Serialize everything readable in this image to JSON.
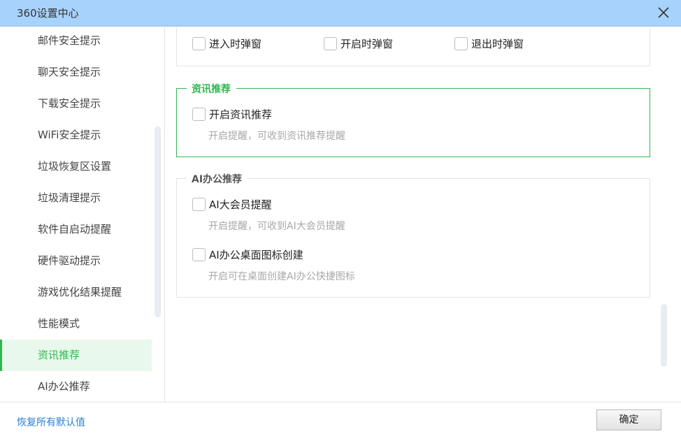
{
  "window": {
    "title": "360设置中心"
  },
  "sidebar": {
    "items": [
      {
        "label": "邮件安全提示"
      },
      {
        "label": "聊天安全提示"
      },
      {
        "label": "下载安全提示"
      },
      {
        "label": "WiFi安全提示"
      },
      {
        "label": "垃圾恢复区设置"
      },
      {
        "label": "垃圾清理提示"
      },
      {
        "label": "软件自启动提醒"
      },
      {
        "label": "硬件驱动提示"
      },
      {
        "label": "游戏优化结果提醒"
      },
      {
        "label": "性能模式"
      },
      {
        "label": "资讯推荐",
        "active": true
      },
      {
        "label": "AI办公推荐"
      }
    ]
  },
  "popup_section": {
    "options": [
      {
        "label": "进入时弹窗",
        "checked": false
      },
      {
        "label": "开启时弹窗",
        "checked": false
      },
      {
        "label": "退出时弹窗",
        "checked": false
      }
    ]
  },
  "news_section": {
    "title": "资讯推荐",
    "option": {
      "label": "开启资讯推荐",
      "checked": false
    },
    "hint": "开启提醒，可收到资讯推荐提醒"
  },
  "ai_section": {
    "title": "AI办公推荐",
    "options": [
      {
        "label": "AI大会员提醒",
        "checked": false,
        "hint": "开启提醒，可收到AI大会员提醒"
      },
      {
        "label": "AI办公桌面图标创建",
        "checked": false,
        "hint": "开启可在桌面创建AI办公快捷图标"
      }
    ]
  },
  "footer": {
    "reset_label": "恢复所有默认值",
    "ok_label": "确定"
  },
  "colors": {
    "accent": "#2db84d",
    "titlebar": "#a7d2fb",
    "link": "#2a7fd6"
  }
}
